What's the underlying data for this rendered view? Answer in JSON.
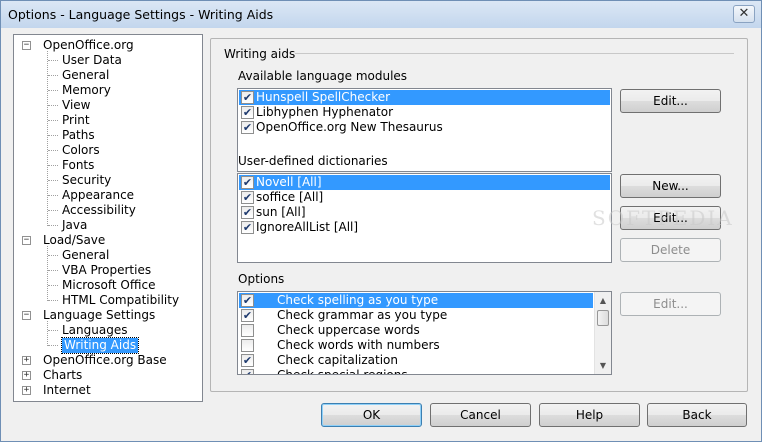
{
  "window": {
    "title": "Options - Language Settings - Writing Aids",
    "close_glyph": "✕"
  },
  "tree": {
    "items": [
      {
        "label": "OpenOffice.org",
        "level": 0,
        "expander": "−"
      },
      {
        "label": "User Data",
        "level": 1
      },
      {
        "label": "General",
        "level": 1
      },
      {
        "label": "Memory",
        "level": 1
      },
      {
        "label": "View",
        "level": 1
      },
      {
        "label": "Print",
        "level": 1
      },
      {
        "label": "Paths",
        "level": 1
      },
      {
        "label": "Colors",
        "level": 1
      },
      {
        "label": "Fonts",
        "level": 1
      },
      {
        "label": "Security",
        "level": 1
      },
      {
        "label": "Appearance",
        "level": 1
      },
      {
        "label": "Accessibility",
        "level": 1
      },
      {
        "label": "Java",
        "level": 1
      },
      {
        "label": "Load/Save",
        "level": 0,
        "expander": "−"
      },
      {
        "label": "General",
        "level": 1
      },
      {
        "label": "VBA Properties",
        "level": 1
      },
      {
        "label": "Microsoft Office",
        "level": 1
      },
      {
        "label": "HTML Compatibility",
        "level": 1
      },
      {
        "label": "Language Settings",
        "level": 0,
        "expander": "−"
      },
      {
        "label": "Languages",
        "level": 1
      },
      {
        "label": "Writing Aids",
        "level": 1,
        "selected": true
      },
      {
        "label": "OpenOffice.org Base",
        "level": 0,
        "expander": "+"
      },
      {
        "label": "Charts",
        "level": 0,
        "expander": "+"
      },
      {
        "label": "Internet",
        "level": 0,
        "expander": "+"
      }
    ]
  },
  "writing_aids": {
    "title": "Writing aids",
    "modules_label": "Available language modules",
    "modules": [
      {
        "label": "Hunspell SpellChecker",
        "checked": true,
        "selected": true
      },
      {
        "label": "Libhyphen Hyphenator",
        "checked": true
      },
      {
        "label": "OpenOffice.org New Thesaurus",
        "checked": true
      }
    ],
    "modules_edit": "Edit...",
    "dicts_label": "User-defined dictionaries",
    "dicts": [
      {
        "label": "Novell [All]",
        "checked": true,
        "selected": true
      },
      {
        "label": "soffice [All]",
        "checked": true
      },
      {
        "label": "sun [All]",
        "checked": true
      },
      {
        "label": "IgnoreAllList [All]",
        "checked": true
      }
    ],
    "dicts_new": "New...",
    "dicts_edit": "Edit...",
    "dicts_delete": "Delete",
    "options_label": "Options",
    "options": [
      {
        "label": "Check spelling as you type",
        "checked": true,
        "selected": true
      },
      {
        "label": "Check grammar as you type",
        "checked": true
      },
      {
        "label": "Check uppercase words",
        "checked": false
      },
      {
        "label": "Check words with numbers",
        "checked": false
      },
      {
        "label": "Check capitalization",
        "checked": true
      },
      {
        "label": "Check special regions",
        "checked": true
      }
    ],
    "options_edit": "Edit..."
  },
  "footer": {
    "ok": "OK",
    "cancel": "Cancel",
    "help": "Help",
    "back": "Back"
  },
  "watermark": "SOFTPEDIA",
  "colors": {
    "selection": "#3399ff",
    "title_bar": "#c3d6ed"
  }
}
